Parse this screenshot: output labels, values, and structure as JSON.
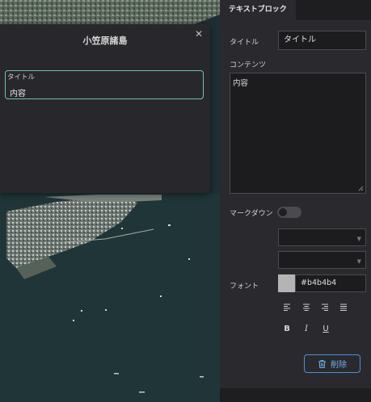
{
  "popup": {
    "title": "小笠原諸島",
    "block": {
      "title": "タイトル",
      "content": "内容"
    }
  },
  "panel": {
    "tab_label": "テキストブロック",
    "title_label": "タイトル",
    "title_value": "タイトル",
    "content_label": "コンテンツ",
    "content_value": "内容",
    "markdown_label": "マークダウン",
    "markdown_enabled": false,
    "font_label": "フォント",
    "font_color_hex": "#b4b4b4",
    "delete_label": "削除"
  },
  "icons": [
    "close-icon",
    "align-left-icon",
    "align-center-icon",
    "align-right-icon",
    "align-justify-icon",
    "bold-icon",
    "italic-icon",
    "underline-icon",
    "trash-icon",
    "chevron-down-icon"
  ],
  "formatting": {
    "bold": "B",
    "italic": "I",
    "underline": "U"
  },
  "colors": {
    "accent_green": "#6fc3a6",
    "accent_blue": "#4c8fd6",
    "panel_bg": "#2a2a2e",
    "swatch": "#b4b4b4"
  }
}
